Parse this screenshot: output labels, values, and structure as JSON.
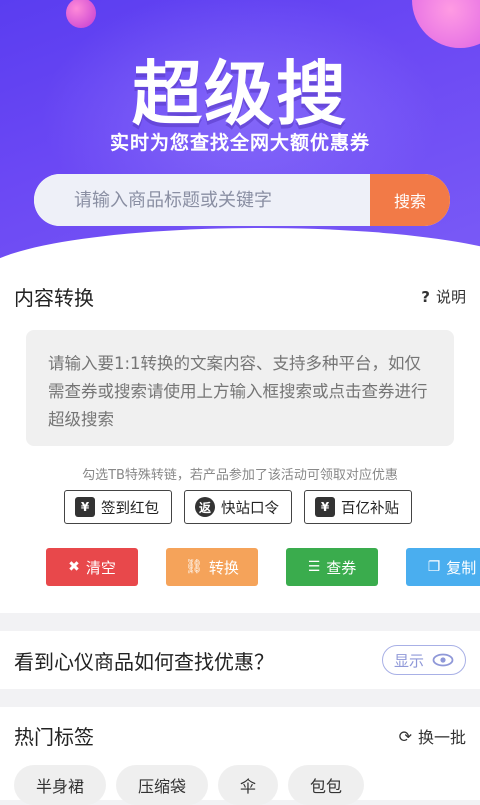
{
  "hero": {
    "title": "超级搜",
    "subtitle": "实时为您查找全网大额优惠券"
  },
  "search": {
    "placeholder": "请输入商品标题或关键字",
    "button_label": "搜索"
  },
  "convert": {
    "title": "内容转换",
    "help_label": "说明",
    "textarea_placeholder": "请输入要1:1转换的文案内容、支持多种平台，如仅需查券或搜索请使用上方输入框搜索或点击查券进行超级搜索",
    "hint": "勾选TB特殊转链，若产品参加了该活动可领取对应优惠",
    "options": [
      {
        "label": "签到红包",
        "icon": "gift-icon"
      },
      {
        "label": "快站口令",
        "icon": "return-icon"
      },
      {
        "label": "百亿补贴",
        "icon": "subsidy-icon"
      }
    ],
    "actions": [
      {
        "label": "清空",
        "color": "#e8484b",
        "icon": "clear-icon"
      },
      {
        "label": "转换",
        "color": "#f5a35a",
        "icon": "link-icon"
      },
      {
        "label": "查券",
        "color": "#3aac4d",
        "icon": "search-list-icon"
      },
      {
        "label": "复制",
        "color": "#4aaeef",
        "icon": "copy-icon"
      }
    ]
  },
  "question": {
    "text": "看到心仪商品如何查找优惠？",
    "show_label": "显示"
  },
  "hot": {
    "title": "热门标签",
    "refresh_label": "换一批",
    "tags": [
      "半身裙",
      "压缩袋",
      "伞",
      "包包"
    ]
  }
}
